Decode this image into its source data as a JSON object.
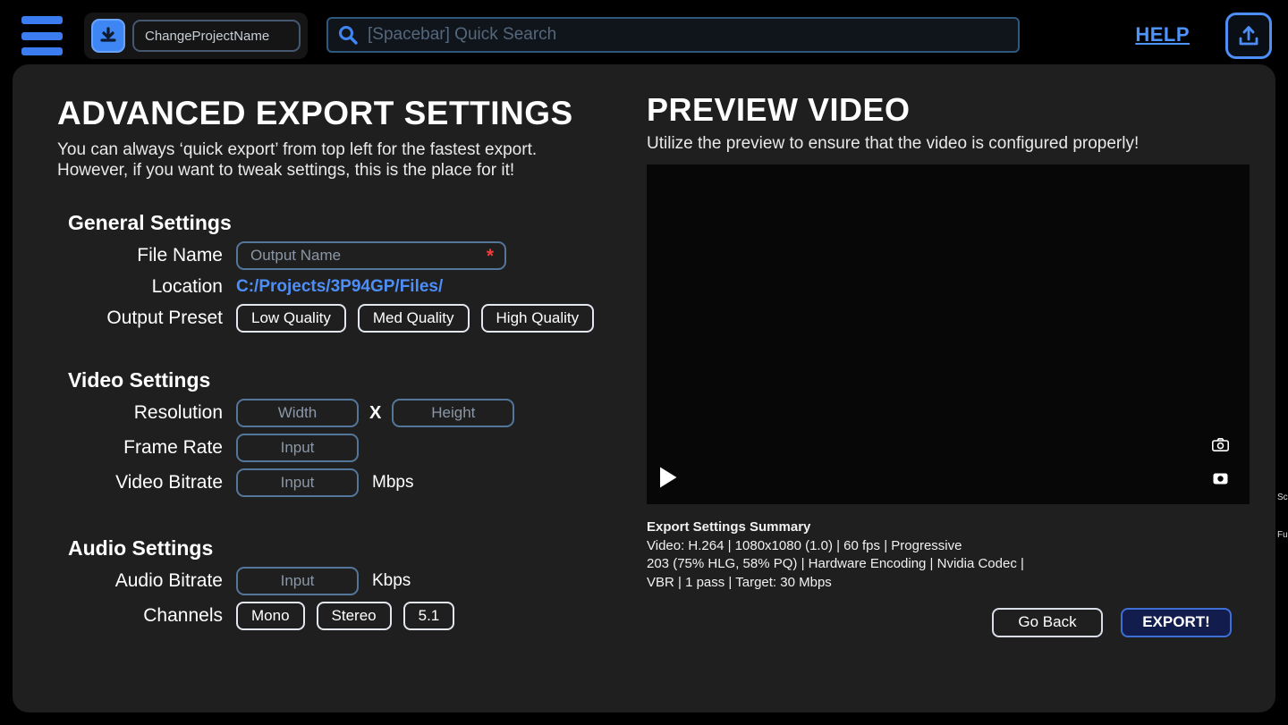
{
  "colors": {
    "accent": "#4d8ef7",
    "panel": "#1f1f1f",
    "required": "#f43b3b",
    "export_fill": "#121d4e"
  },
  "topbar": {
    "project_name": "ChangeProjectName",
    "search_placeholder": "[Spacebar] Quick Search",
    "help_label": "HELP"
  },
  "left": {
    "title": "ADVANCED EXPORT SETTINGS",
    "subtitle_line1": "You can always ‘quick export’ from top left for the fastest export.",
    "subtitle_line2": "However, if you want to tweak settings, this is the place for it!",
    "general": {
      "heading": "General Settings",
      "file_name_label": "File Name",
      "file_name_placeholder": "Output Name",
      "required_marker": "*",
      "location_label": "Location",
      "location_value": "C:/Projects/3P94GP/Files/",
      "output_preset_label": "Output Preset",
      "presets": [
        "Low Quality",
        "Med Quality",
        "High Quality"
      ]
    },
    "video": {
      "heading": "Video Settings",
      "resolution_label": "Resolution",
      "width_placeholder": "Width",
      "x_separator": "X",
      "height_placeholder": "Height",
      "frame_rate_label": "Frame Rate",
      "frame_rate_placeholder": "Input",
      "video_bitrate_label": "Video Bitrate",
      "video_bitrate_placeholder": "Input",
      "video_bitrate_unit": "Mbps"
    },
    "audio": {
      "heading": "Audio Settings",
      "audio_bitrate_label": "Audio Bitrate",
      "audio_bitrate_placeholder": "Input",
      "audio_bitrate_unit": "Kbps",
      "channels_label": "Channels",
      "channel_options": [
        "Mono",
        "Stereo",
        "5.1"
      ]
    }
  },
  "right": {
    "title": "PREVIEW VIDEO",
    "subtitle": "Utilize the preview to ensure that the video is configured properly!",
    "summary": {
      "heading": "Export Settings Summary",
      "line1": "Video: H.264 | 1080x1080 (1.0) | 60 fps | Progressive",
      "line2": "203 (75% HLG, 58% PQ) | Hardware Encoding | Nvidia Codec |",
      "line3": "VBR | 1 pass | Target: 30 Mbps"
    },
    "go_back_label": "Go Back",
    "export_label": "EXPORT!"
  },
  "edge": {
    "clipped_text_1": "Scr",
    "clipped_text_2": "Fu"
  }
}
